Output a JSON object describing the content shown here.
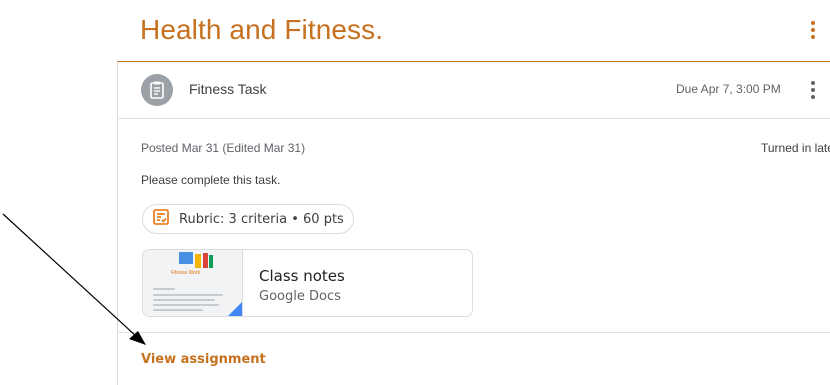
{
  "topic": {
    "title": "Health and Fitness.",
    "menu_icon": "more-vert-icon"
  },
  "assignment": {
    "icon": "assignment-icon",
    "title": "Fitness Task",
    "due": "Due Apr 7, 3:00 PM",
    "menu_icon": "more-vert-icon",
    "posted": "Posted Mar 31 (Edited Mar 31)",
    "status": "Turned in late",
    "instructions": "Please complete this task.",
    "rubric": {
      "icon": "rubric-icon",
      "label": "Rubric: 3 criteria • 60 pts"
    },
    "attachment": {
      "title": "Class notes",
      "type": "Google Docs",
      "thumbnail_heading": "Fitness Work",
      "thumbnail_icon": "doc-thumbnail-icon"
    },
    "view_link": "View assignment"
  },
  "colors": {
    "accent": "#c5711f",
    "doc_blue": "#4285f4",
    "icon_gray": "#9aa0a6"
  }
}
